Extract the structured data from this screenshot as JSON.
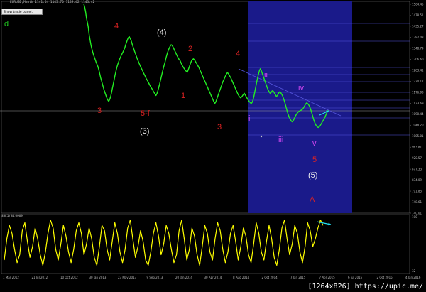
{
  "header": {
    "readout": "EURUSD,Month  1141.64 1143.70 1139.42 1143.42",
    "trade_panel_hint": "Show trade panel, Alt+T",
    "subchart_letter": "d"
  },
  "watermark": "[1264x826] https://upic.me/",
  "oscillator_label": "SSI(5) 84.6069",
  "colors": {
    "background": "#000000",
    "price_line": "#22ee22",
    "oscillator": "#ffff00",
    "highlight_box": "#1a1a8a",
    "fib_line": "#5555dd",
    "annot_red": "#dd2222",
    "annot_white": "#eeeeee",
    "annot_purple": "#cc44ee",
    "arrow": "#22ddee"
  },
  "chart_data": [
    {
      "type": "line",
      "name": "price",
      "y_ticks": [
        "1564.45",
        "1478.51",
        "1435.27",
        "1392.03",
        "1348.79",
        "1306.60",
        "1263.41",
        "1220.17",
        "1176.93",
        "1133.69",
        "1090.44",
        "1048.20",
        "1005.01",
        "963.81",
        "920.57",
        "877.33",
        "834.09",
        "791.85",
        "748.61",
        "740.01"
      ],
      "ylim": [
        740,
        1570
      ],
      "x_ticks": [
        "1 Mar 2012",
        "21 Jul 2012",
        "10 Oct 2012",
        "30 Jan 2013",
        "23 May 2013",
        "9 Sep 2013",
        "20 Jan 2014",
        "30 Apr 2014",
        "8 Aug 2014",
        "2 Oct 2014",
        "7 Jan 2015",
        "7 Apr 2015",
        "6 Jul 2015",
        "2 Oct 2015",
        "4 Jan 2016"
      ],
      "series": [
        {
          "values": [
            1560,
            1548,
            1530,
            1505,
            1488,
            1470,
            1440,
            1420,
            1400,
            1385,
            1372,
            1360,
            1350,
            1340,
            1330,
            1322,
            1313,
            1300,
            1285,
            1270,
            1258,
            1245,
            1232,
            1220,
            1210,
            1200,
            1190,
            1183,
            1178,
            1185,
            1195,
            1210,
            1228,
            1245,
            1262,
            1280,
            1295,
            1310,
            1322,
            1332,
            1342,
            1350,
            1358,
            1365,
            1372,
            1380,
            1388,
            1400,
            1410,
            1420,
            1428,
            1432,
            1425,
            1418,
            1406,
            1395,
            1385,
            1374,
            1365,
            1355,
            1345,
            1337,
            1328,
            1320,
            1312,
            1305,
            1298,
            1290,
            1283,
            1276,
            1268,
            1262,
            1256,
            1249,
            1242,
            1236,
            1230,
            1225,
            1218,
            1212,
            1206,
            1201,
            1208,
            1218,
            1232,
            1245,
            1260,
            1275,
            1290,
            1305,
            1318,
            1330,
            1345,
            1358,
            1370,
            1380,
            1388,
            1395,
            1400,
            1398,
            1392,
            1385,
            1377,
            1370,
            1362,
            1355,
            1348,
            1342,
            1338,
            1330,
            1322,
            1316,
            1310,
            1305,
            1300,
            1296,
            1292,
            1300,
            1310,
            1320,
            1330,
            1338,
            1342,
            1345,
            1342,
            1336,
            1330,
            1324,
            1318,
            1312,
            1304,
            1296,
            1288,
            1280,
            1272,
            1264,
            1256,
            1248,
            1240,
            1232,
            1224,
            1216,
            1208,
            1200,
            1192,
            1184,
            1176,
            1170,
            1175,
            1185,
            1195,
            1205,
            1215,
            1225,
            1235,
            1245,
            1255,
            1262,
            1270,
            1278,
            1285,
            1290,
            1288,
            1282,
            1276,
            1270,
            1262,
            1254,
            1246,
            1238,
            1230,
            1222,
            1214,
            1206,
            1200,
            1195,
            1192,
            1195,
            1200,
            1205,
            1210,
            1204,
            1198,
            1192,
            1186,
            1180,
            1176,
            1172,
            1170,
            1175,
            1185,
            1200,
            1218,
            1236,
            1254,
            1270,
            1285,
            1298,
            1306,
            1300,
            1290,
            1280,
            1270,
            1260,
            1250,
            1240,
            1230,
            1222,
            1215,
            1210,
            1212,
            1218,
            1220,
            1216,
            1210,
            1204,
            1198,
            1200,
            1206,
            1212,
            1216,
            1212,
            1206,
            1200,
            1190,
            1180,
            1168,
            1155,
            1142,
            1130,
            1120,
            1112,
            1106,
            1100,
            1098,
            1102,
            1110,
            1118,
            1124,
            1130,
            1134,
            1138,
            1140,
            1142,
            1144,
            1146,
            1150,
            1156,
            1162,
            1168,
            1172,
            1170,
            1166,
            1160,
            1152,
            1142,
            1130,
            1118,
            1106,
            1096,
            1088,
            1082,
            1078,
            1076,
            1078,
            1082,
            1088,
            1094,
            1100,
            1106,
            1112,
            1120,
            1128,
            1136,
            1143
          ]
        }
      ]
    },
    {
      "type": "line",
      "name": "oscillator",
      "y_ticks": [
        "100",
        "32"
      ],
      "ylim": [
        0,
        100
      ],
      "series": [
        {
          "values": [
            20,
            60,
            85,
            70,
            40,
            15,
            30,
            75,
            90,
            55,
            25,
            45,
            80,
            60,
            30,
            10,
            35,
            70,
            95,
            80,
            40,
            20,
            50,
            85,
            65,
            35,
            15,
            40,
            75,
            90,
            70,
            30,
            50,
            80,
            60,
            25,
            10,
            45,
            85,
            75,
            40,
            20,
            55,
            90,
            70,
            35,
            15,
            40,
            80,
            95,
            60,
            25,
            45,
            75,
            55,
            20,
            10,
            35,
            70,
            90,
            65,
            30,
            50,
            85,
            70,
            40,
            15,
            30,
            75,
            95,
            60,
            20,
            40,
            80,
            65,
            30,
            10,
            45,
            85,
            70,
            35,
            20,
            60,
            90,
            75,
            40,
            15,
            35,
            70,
            85,
            55,
            20,
            45,
            80,
            65,
            30,
            15,
            50,
            90,
            70,
            35,
            20,
            55,
            85,
            60,
            25,
            10,
            40,
            80,
            95,
            60,
            30,
            50,
            85,
            70,
            35,
            15,
            45,
            90,
            75,
            45,
            60,
            80,
            95,
            85
          ]
        }
      ]
    }
  ],
  "annotations": {
    "red": [
      "4",
      "2",
      "4",
      "3",
      "1",
      "3",
      "5",
      "A",
      "5-f"
    ],
    "white": [
      "(4)",
      "(3)",
      "(5)"
    ],
    "purple": [
      "ii",
      "iv",
      "i",
      "iii",
      "v"
    ]
  }
}
